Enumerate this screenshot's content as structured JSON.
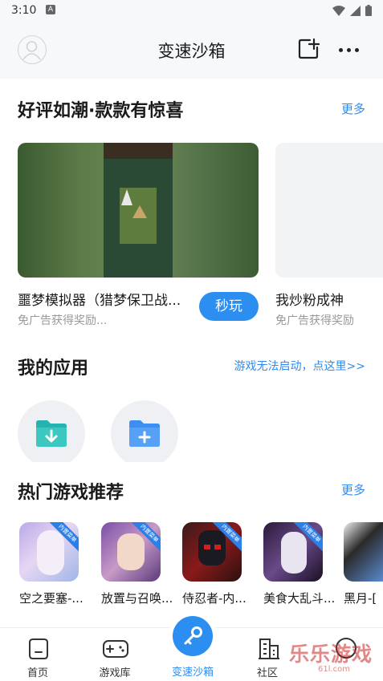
{
  "status": {
    "time": "3:10",
    "notification": "A"
  },
  "header": {
    "title": "变速沙箱"
  },
  "featured": {
    "title": "好评如潮·款款有惊喜",
    "more": "更多",
    "cards": [
      {
        "name": "噩梦模拟器（猎梦保卫战...",
        "subtitle": "免广告获得奖励...",
        "button": "秒玩"
      },
      {
        "name": "我炒粉成神",
        "subtitle": "免广告获得奖励"
      }
    ]
  },
  "my_apps": {
    "title": "我的应用",
    "link": "游戏无法启动，点这里>>"
  },
  "hot_games": {
    "title": "热门游戏推荐",
    "more": "更多",
    "items": [
      {
        "name": "空之要塞-...",
        "badge": "内置菜单"
      },
      {
        "name": "放置与召唤...",
        "badge": "内置菜单"
      },
      {
        "name": "侍忍者-内...",
        "badge": "内置菜单"
      },
      {
        "name": "美食大乱斗...",
        "badge": "内置菜单"
      },
      {
        "name": "黑月-["
      }
    ]
  },
  "nav": {
    "items": [
      {
        "label": "首页"
      },
      {
        "label": "游戏库"
      },
      {
        "label": "变速沙箱"
      },
      {
        "label": "社区"
      }
    ]
  },
  "watermark": {
    "text": "乐乐游戏",
    "sub": "61l.com"
  },
  "colors": {
    "accent": "#2b8ef0",
    "link": "#2f8cf0",
    "teal": "#25b3b0",
    "folder_blue": "#3c8ef0"
  }
}
